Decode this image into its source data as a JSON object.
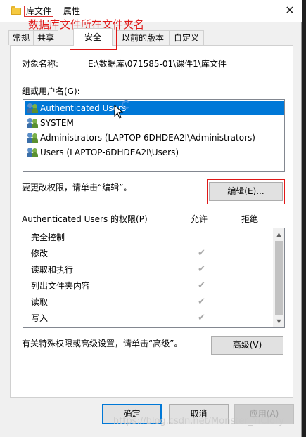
{
  "window": {
    "title_name": "库文件",
    "title_suffix": "属性",
    "close_glyph": "✕"
  },
  "annotation": {
    "text": "数据库文件所在文件夹名",
    "color": "#e01818"
  },
  "tabs": [
    {
      "label": "常规"
    },
    {
      "label": "共享"
    },
    {
      "label": "安全",
      "active": true
    },
    {
      "label": "以前的版本"
    },
    {
      "label": "自定义"
    }
  ],
  "security": {
    "object_label": "对象名称:",
    "object_value": "E:\\数据库\\071585-01\\课件1\\库文件",
    "group_label": "组或用户名(G):",
    "users": [
      {
        "name": "Authenticated Users",
        "selected": true
      },
      {
        "name": "SYSTEM"
      },
      {
        "name": "Administrators (LAPTOP-6DHDEA2I\\Administrators)"
      },
      {
        "name": "Users (LAPTOP-6DHDEA2I\\Users)"
      }
    ],
    "change_hint": "要更改权限，请单击“编辑”。",
    "edit_button": "编辑(E)...",
    "perm_title": "Authenticated Users 的权限(P)",
    "allow_header": "允许",
    "deny_header": "拒绝",
    "permissions": [
      {
        "name": "完全控制",
        "allow": false
      },
      {
        "name": "修改",
        "allow": true
      },
      {
        "name": "读取和执行",
        "allow": true
      },
      {
        "name": "列出文件夹内容",
        "allow": true
      },
      {
        "name": "读取",
        "allow": true
      },
      {
        "name": "写入",
        "allow": true
      }
    ],
    "check_glyph": "✔",
    "advanced_hint": "有关特殊权限或高级设置，请单击“高级”。",
    "advanced_button": "高级(V)"
  },
  "footer": {
    "ok": "确定",
    "cancel": "取消",
    "apply": "应用(A)"
  },
  "watermark": "https://blog.csdn.net/Monster_YiClory",
  "colors": {
    "accent": "#0078d7",
    "annotation_red": "#e01818"
  }
}
